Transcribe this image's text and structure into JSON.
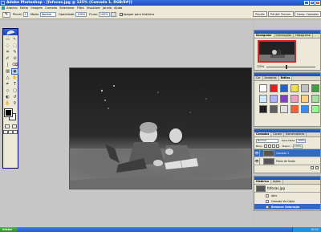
{
  "window": {
    "title": "Adobe Photoshop - [fofocas.jpg @ 125% (Camada 1, RGB/8#)]",
    "controls": [
      "_",
      "▫",
      "x"
    ]
  },
  "menubar": {
    "items": [
      "Arquivo",
      "Editar",
      "Imagem",
      "Camada",
      "Selecionar",
      "Filtro",
      "Visualizar",
      "Janela",
      "Ajuda"
    ]
  },
  "options": {
    "tool_preset_icon": "brush-icon",
    "brush_label": "Pincel:",
    "brush_size": "1",
    "mode_label": "Modo:",
    "mode_value": "Normal",
    "opacity_label": "Opacidade:",
    "opacity_value": "100%",
    "flow_label": "Fluxo:",
    "flow_value": "100%",
    "airbrush_icon": "airbrush-icon",
    "erase_to_history_label": "Apagar para histórico",
    "palette_tabs": [
      "Pincéis",
      "Pré-def. Ferram.",
      "Comp. Camadas"
    ]
  },
  "toolbox": {
    "tools": [
      "▭",
      "↖",
      "◌",
      "⬚",
      "⌗",
      "✎",
      "✐",
      "⊙",
      "❘",
      "⌫",
      "▨",
      "◉",
      "△",
      "✋",
      "✒",
      "T",
      "◇",
      "▢",
      "◐",
      "↺",
      "✋",
      "⚲"
    ],
    "active_index": 11
  },
  "document": {
    "filename": "fofocas.jpg"
  },
  "navigator": {
    "tabs": [
      "Navegador",
      "Informações",
      "Histograma"
    ],
    "active_tab": 0,
    "zoom": "125%"
  },
  "styles": {
    "tabs": [
      "Cor",
      "Amostras",
      "Estilos"
    ],
    "active_tab": 2,
    "swatches": [
      "#ffffff",
      "#e02020",
      "#2060e0",
      "#f0e040",
      "#c0c0c0",
      "#40a040",
      "#d0e8ff",
      "#b0b0ff",
      "#8040c0",
      "#f0a0c0",
      "#ffd080",
      "#a0e0a0",
      "#202020",
      "#606060",
      "#e0e0e0",
      "#ff6030",
      "#3090ff",
      "#90ff90"
    ]
  },
  "layers": {
    "tabs": [
      "Camadas",
      "Canais",
      "Demarcadores"
    ],
    "active_tab": 0,
    "blend_mode": "Normal",
    "opacity_label": "Opacidade:",
    "opacity_value": "100%",
    "lock_label": "Bloq.:",
    "fill_label": "Preenc.:",
    "fill_value": "100%",
    "items": [
      {
        "name": "Camada 1",
        "selected": true
      },
      {
        "name": "Plano de fundo",
        "selected": false
      }
    ]
  },
  "history": {
    "tabs": [
      "Histórico",
      "Ações"
    ],
    "active_tab": 0,
    "snapshot": "fofocas.jpg",
    "steps": [
      {
        "name": "Abrir",
        "selected": false
      },
      {
        "name": "Camada Via Cópia",
        "selected": false
      },
      {
        "name": "Remover Saturação",
        "selected": true
      }
    ]
  },
  "taskbar": {
    "start_label": "iniciar",
    "clock": "10:52"
  }
}
